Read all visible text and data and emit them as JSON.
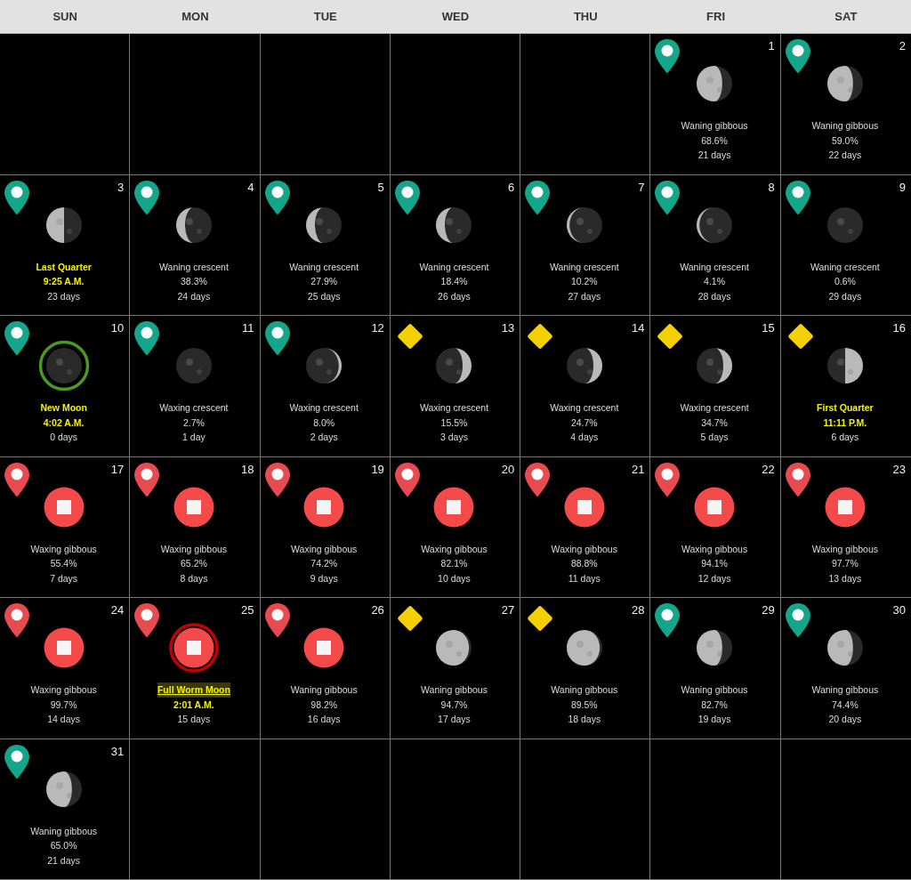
{
  "weekdays": [
    "SUN",
    "MON",
    "TUE",
    "WED",
    "THU",
    "FRI",
    "SAT"
  ],
  "weeks": [
    [
      {
        "kind": "blank"
      },
      {
        "kind": "blank"
      },
      {
        "kind": "blank"
      },
      {
        "kind": "blank"
      },
      {
        "kind": "blank"
      },
      {
        "kind": "day",
        "day": "1",
        "marker": {
          "kind": "pin",
          "color": "#13a68a"
        },
        "moon": {
          "kind": "gibbous",
          "waxing": false
        },
        "name": "Waning gibbous",
        "detail": "68.6%",
        "age": "21 days",
        "event": false
      },
      {
        "kind": "day",
        "day": "2",
        "marker": {
          "kind": "pin",
          "color": "#13a68a"
        },
        "moon": {
          "kind": "gibbous",
          "waxing": false
        },
        "name": "Waning gibbous",
        "detail": "59.0%",
        "age": "22 days",
        "event": false
      }
    ],
    [
      {
        "kind": "day",
        "day": "3",
        "marker": {
          "kind": "pin",
          "color": "#13a68a"
        },
        "moon": {
          "kind": "quarter",
          "waxing": false
        },
        "name": "Last Quarter",
        "detail": "9:25 A.M.",
        "age": "23 days",
        "event": true
      },
      {
        "kind": "day",
        "day": "4",
        "marker": {
          "kind": "pin",
          "color": "#13a68a"
        },
        "moon": {
          "kind": "crescent",
          "waxing": false
        },
        "name": "Waning crescent",
        "detail": "38.3%",
        "age": "24 days",
        "event": false
      },
      {
        "kind": "day",
        "day": "5",
        "marker": {
          "kind": "pin",
          "color": "#13a68a"
        },
        "moon": {
          "kind": "crescent",
          "waxing": false
        },
        "name": "Waning crescent",
        "detail": "27.9%",
        "age": "25 days",
        "event": false
      },
      {
        "kind": "day",
        "day": "6",
        "marker": {
          "kind": "pin",
          "color": "#13a68a"
        },
        "moon": {
          "kind": "crescent",
          "waxing": false
        },
        "name": "Waning crescent",
        "detail": "18.4%",
        "age": "26 days",
        "event": false
      },
      {
        "kind": "day",
        "day": "7",
        "marker": {
          "kind": "pin",
          "color": "#13a68a"
        },
        "moon": {
          "kind": "thin",
          "waxing": false
        },
        "name": "Waning crescent",
        "detail": "10.2%",
        "age": "27 days",
        "event": false
      },
      {
        "kind": "day",
        "day": "8",
        "marker": {
          "kind": "pin",
          "color": "#13a68a"
        },
        "moon": {
          "kind": "thin",
          "waxing": false
        },
        "name": "Waning crescent",
        "detail": "4.1%",
        "age": "28 days",
        "event": false
      },
      {
        "kind": "day",
        "day": "9",
        "marker": {
          "kind": "pin",
          "color": "#13a68a"
        },
        "moon": {
          "kind": "new"
        },
        "name": "Waning crescent",
        "detail": "0.6%",
        "age": "29 days",
        "event": false
      }
    ],
    [
      {
        "kind": "day",
        "day": "10",
        "marker": {
          "kind": "pin",
          "color": "#13a68a"
        },
        "moon": {
          "kind": "new",
          "ringed": true
        },
        "name": "New Moon",
        "detail": "4:02 A.M.",
        "age": "0 days",
        "event": true
      },
      {
        "kind": "day",
        "day": "11",
        "marker": {
          "kind": "pin",
          "color": "#13a68a"
        },
        "moon": {
          "kind": "new"
        },
        "name": "Waxing crescent",
        "detail": "2.7%",
        "age": "1 day",
        "event": false
      },
      {
        "kind": "day",
        "day": "12",
        "marker": {
          "kind": "pin",
          "color": "#13a68a"
        },
        "moon": {
          "kind": "thin",
          "waxing": true
        },
        "name": "Waxing crescent",
        "detail": "8.0%",
        "age": "2 days",
        "event": false
      },
      {
        "kind": "day",
        "day": "13",
        "marker": {
          "kind": "diamond",
          "color": "#f5d000"
        },
        "moon": {
          "kind": "crescent",
          "waxing": true
        },
        "name": "Waxing crescent",
        "detail": "15.5%",
        "age": "3 days",
        "event": false
      },
      {
        "kind": "day",
        "day": "14",
        "marker": {
          "kind": "diamond",
          "color": "#f5d000"
        },
        "moon": {
          "kind": "crescent",
          "waxing": true
        },
        "name": "Waxing crescent",
        "detail": "24.7%",
        "age": "4 days",
        "event": false
      },
      {
        "kind": "day",
        "day": "15",
        "marker": {
          "kind": "diamond",
          "color": "#f5d000"
        },
        "moon": {
          "kind": "crescent",
          "waxing": true
        },
        "name": "Waxing crescent",
        "detail": "34.7%",
        "age": "5 days",
        "event": false
      },
      {
        "kind": "day",
        "day": "16",
        "marker": {
          "kind": "diamond",
          "color": "#f5d000"
        },
        "moon": {
          "kind": "quarter",
          "waxing": true
        },
        "name": "First Quarter",
        "detail": "11:11 P.M.",
        "age": "6 days",
        "event": true
      }
    ],
    [
      {
        "kind": "day",
        "day": "17",
        "marker": {
          "kind": "pin",
          "color": "#e84b4f"
        },
        "moon": {
          "kind": "stop"
        },
        "name": "Waxing gibbous",
        "detail": "55.4%",
        "age": "7 days",
        "event": false
      },
      {
        "kind": "day",
        "day": "18",
        "marker": {
          "kind": "pin",
          "color": "#e84b4f"
        },
        "moon": {
          "kind": "stop"
        },
        "name": "Waxing gibbous",
        "detail": "65.2%",
        "age": "8 days",
        "event": false
      },
      {
        "kind": "day",
        "day": "19",
        "marker": {
          "kind": "pin",
          "color": "#e84b4f"
        },
        "moon": {
          "kind": "stop"
        },
        "name": "Waxing gibbous",
        "detail": "74.2%",
        "age": "9 days",
        "event": false
      },
      {
        "kind": "day",
        "day": "20",
        "marker": {
          "kind": "pin",
          "color": "#e84b4f"
        },
        "moon": {
          "kind": "stop"
        },
        "name": "Waxing gibbous",
        "detail": "82.1%",
        "age": "10 days",
        "event": false
      },
      {
        "kind": "day",
        "day": "21",
        "marker": {
          "kind": "pin",
          "color": "#e84b4f"
        },
        "moon": {
          "kind": "stop"
        },
        "name": "Waxing gibbous",
        "detail": "88.8%",
        "age": "11 days",
        "event": false
      },
      {
        "kind": "day",
        "day": "22",
        "marker": {
          "kind": "pin",
          "color": "#e84b4f"
        },
        "moon": {
          "kind": "stop"
        },
        "name": "Waxing gibbous",
        "detail": "94.1%",
        "age": "12 days",
        "event": false
      },
      {
        "kind": "day",
        "day": "23",
        "marker": {
          "kind": "pin",
          "color": "#e84b4f"
        },
        "moon": {
          "kind": "stop"
        },
        "name": "Waxing gibbous",
        "detail": "97.7%",
        "age": "13 days",
        "event": false
      }
    ],
    [
      {
        "kind": "day",
        "day": "24",
        "marker": {
          "kind": "pin",
          "color": "#e84b4f"
        },
        "moon": {
          "kind": "stop"
        },
        "name": "Waxing gibbous",
        "detail": "99.7%",
        "age": "14 days",
        "event": false
      },
      {
        "kind": "day",
        "day": "25",
        "marker": {
          "kind": "pin",
          "color": "#e84b4f"
        },
        "moon": {
          "kind": "stop",
          "ringed": true
        },
        "name": "Full Worm Moon",
        "detail": "2:01 A.M.",
        "age": "15 days",
        "event": true,
        "link": true
      },
      {
        "kind": "day",
        "day": "26",
        "marker": {
          "kind": "pin",
          "color": "#e84b4f"
        },
        "moon": {
          "kind": "stop"
        },
        "name": "Waning gibbous",
        "detail": "98.2%",
        "age": "16 days",
        "event": false
      },
      {
        "kind": "day",
        "day": "27",
        "marker": {
          "kind": "diamond",
          "color": "#f5d000"
        },
        "moon": {
          "kind": "full",
          "waxing": false
        },
        "name": "Waning gibbous",
        "detail": "94.7%",
        "age": "17 days",
        "event": false
      },
      {
        "kind": "day",
        "day": "28",
        "marker": {
          "kind": "diamond",
          "color": "#f5d000"
        },
        "moon": {
          "kind": "full",
          "waxing": false
        },
        "name": "Waning gibbous",
        "detail": "89.5%",
        "age": "18 days",
        "event": false
      },
      {
        "kind": "day",
        "day": "29",
        "marker": {
          "kind": "pin",
          "color": "#13a68a"
        },
        "moon": {
          "kind": "gibbous",
          "waxing": false
        },
        "name": "Waning gibbous",
        "detail": "82.7%",
        "age": "19 days",
        "event": false
      },
      {
        "kind": "day",
        "day": "30",
        "marker": {
          "kind": "pin",
          "color": "#13a68a"
        },
        "moon": {
          "kind": "gibbous",
          "waxing": false
        },
        "name": "Waning gibbous",
        "detail": "74.4%",
        "age": "20 days",
        "event": false
      }
    ],
    [
      {
        "kind": "day",
        "day": "31",
        "marker": {
          "kind": "pin",
          "color": "#13a68a"
        },
        "moon": {
          "kind": "gibbous",
          "waxing": false
        },
        "name": "Waning gibbous",
        "detail": "65.0%",
        "age": "21 days",
        "event": false
      },
      {
        "kind": "blank"
      },
      {
        "kind": "blank"
      },
      {
        "kind": "blank"
      },
      {
        "kind": "blank"
      },
      {
        "kind": "blank"
      },
      {
        "kind": "blank"
      }
    ]
  ]
}
